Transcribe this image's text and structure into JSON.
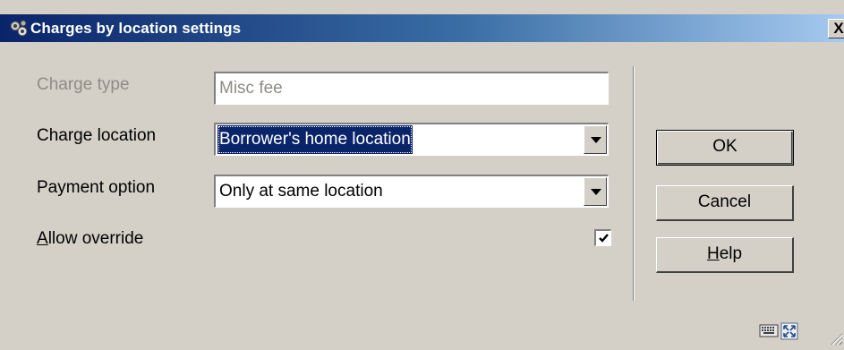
{
  "window": {
    "title": "Charges by location settings",
    "close_label": "X",
    "icon": "gear-cluster-icon"
  },
  "form": {
    "charge_type": {
      "label": "Charge type",
      "value": "Misc fee"
    },
    "charge_location": {
      "label": "Charge location",
      "value": "Borrower's home location"
    },
    "payment_option": {
      "label": "Payment option",
      "value": "Only at same location"
    },
    "allow_override": {
      "label_mnemonic": "A",
      "label_rest": "llow override",
      "checked": true
    }
  },
  "buttons": {
    "ok": "OK",
    "cancel": "Cancel",
    "help_mnemonic": "H",
    "help_rest": "elp"
  },
  "status_icons": [
    "keyboard-icon",
    "maximize-icon",
    "resize-grip-icon"
  ],
  "colors": {
    "title_start": "#0a246a",
    "title_end": "#a6caf0",
    "face": "#d4d0c8",
    "selection": "#0a246a",
    "disabled_text": "#8f8c85"
  }
}
